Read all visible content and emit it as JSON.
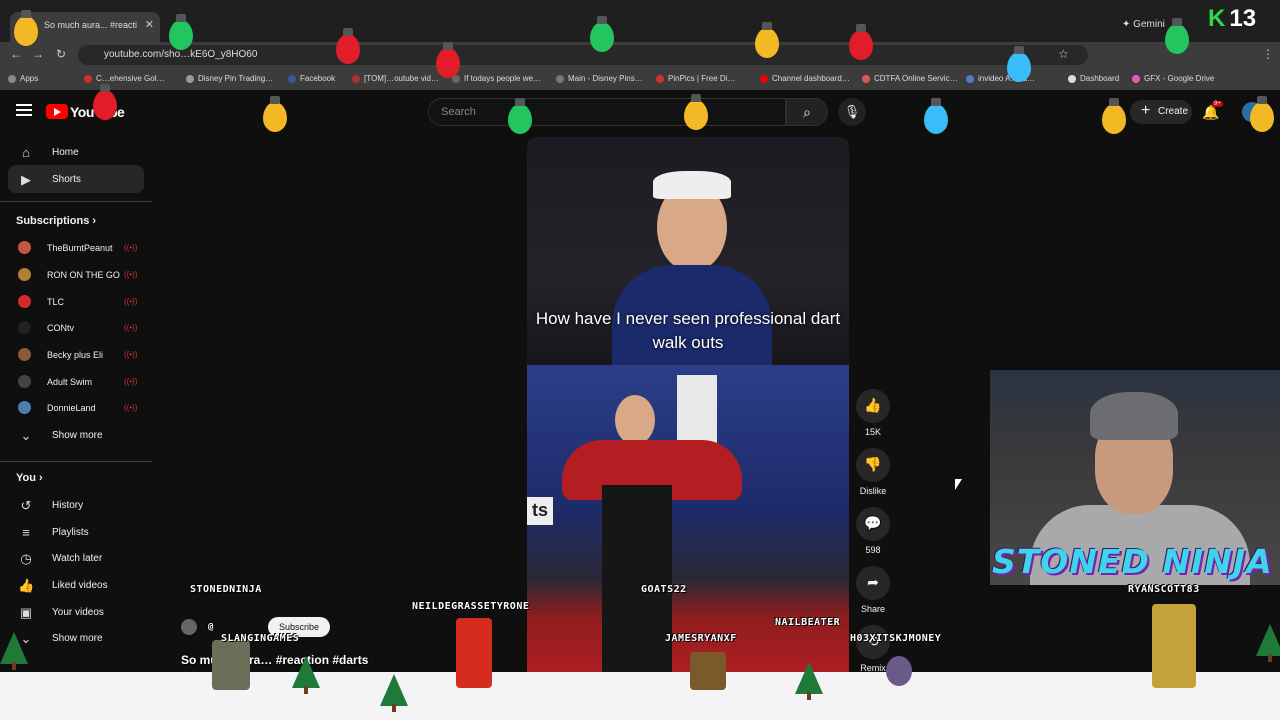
{
  "browser": {
    "tab_title": "So much aura... #reacti",
    "url": "youtube.com/sho…kE6O_y8HO60",
    "gemini_label": "Gemini",
    "bookmarks": [
      "Apps",
      "C…ehensive Gol…",
      "Disney Pin Trading…",
      "Facebook",
      "[TOM]…outube vid…",
      "If todays people we…",
      "Main - Disney Pins…",
      "PinPics | Free Di…",
      "Channel dashboard…",
      "CDTFA Online Servic…",
      "invideo A… id…",
      "Dashboard",
      "GFX - Google Drive"
    ]
  },
  "header": {
    "logo_text": "YouTube",
    "search_placeholder": "Search",
    "create_label": "Create",
    "notifications_badge": "9+"
  },
  "sidebar": {
    "main": [
      {
        "label": "Home",
        "icon": "home-icon"
      },
      {
        "label": "Shorts",
        "icon": "shorts-icon"
      }
    ],
    "subscriptions_heading": "Subscriptions",
    "channels": [
      {
        "name": "TheBurntPeanut",
        "color": "#c8553d"
      },
      {
        "name": "RON ON THE GO",
        "color": "#b08030"
      },
      {
        "name": "TLC",
        "color": "#d22b2b"
      },
      {
        "name": "CONtv",
        "color": "#222222"
      },
      {
        "name": "Becky plus Eli",
        "color": "#8a5a3b"
      },
      {
        "name": "Adult Swim",
        "color": "#444444"
      },
      {
        "name": "DonnieLand",
        "color": "#4a7fb0"
      }
    ],
    "show_more": "Show more",
    "you_heading": "You",
    "you_items": [
      {
        "label": "History",
        "icon": "history-icon"
      },
      {
        "label": "Playlists",
        "icon": "playlists-icon"
      },
      {
        "label": "Watch later",
        "icon": "watch-later-icon"
      },
      {
        "label": "Liked videos",
        "icon": "liked-icon"
      },
      {
        "label": "Your videos",
        "icon": "your-videos-icon"
      }
    ],
    "show_more_2": "Show more"
  },
  "short": {
    "caption": "How have I never seen professional dart walk outs",
    "side_logo": "ts",
    "title": "So much aura… #reaction #darts",
    "subscribe_label": "Subscribe",
    "channel_handle": "@"
  },
  "actions": {
    "like_count": "15K",
    "dislike_label": "Dislike",
    "comment_count": "598",
    "share_label": "Share",
    "remix_label": "Remix"
  },
  "overlay": {
    "streamer_name": "STONED NINJA",
    "counter": "13",
    "viewers": [
      "STONEDNINJA",
      "SLANGINGAMES",
      "NEILDEGRASSETYRONE",
      "GOATS22",
      "JAMESRYANXF",
      "NAILBEATER",
      "H03XITSKJMONEY",
      "RYANSCOTT83"
    ]
  },
  "colors": {
    "yt_red": "#ff0000",
    "bg": "#0f0f0f",
    "ninja_text": "#3fd5e8",
    "bulb_colors": [
      "#f2b925",
      "#22c55e",
      "#e11d2a",
      "#38bdf8"
    ]
  }
}
